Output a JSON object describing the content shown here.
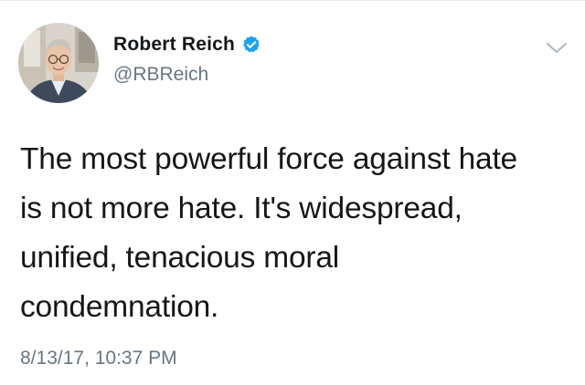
{
  "tweet": {
    "author": {
      "display_name": "Robert Reich",
      "handle": "@RBReich",
      "verified": true,
      "avatar": "profile-photo"
    },
    "text": "The most powerful force against hate\nis not more hate. It's widespread,\nunified, tenacious moral\ncondemnation.",
    "timestamp": "8/13/17, 10:37 PM",
    "menu_icon": "chevron-down-icon"
  },
  "colors": {
    "text_primary": "#14171a",
    "text_secondary": "#657786",
    "verified_badge": "#1da1f2",
    "caret": "#aab8c2"
  }
}
